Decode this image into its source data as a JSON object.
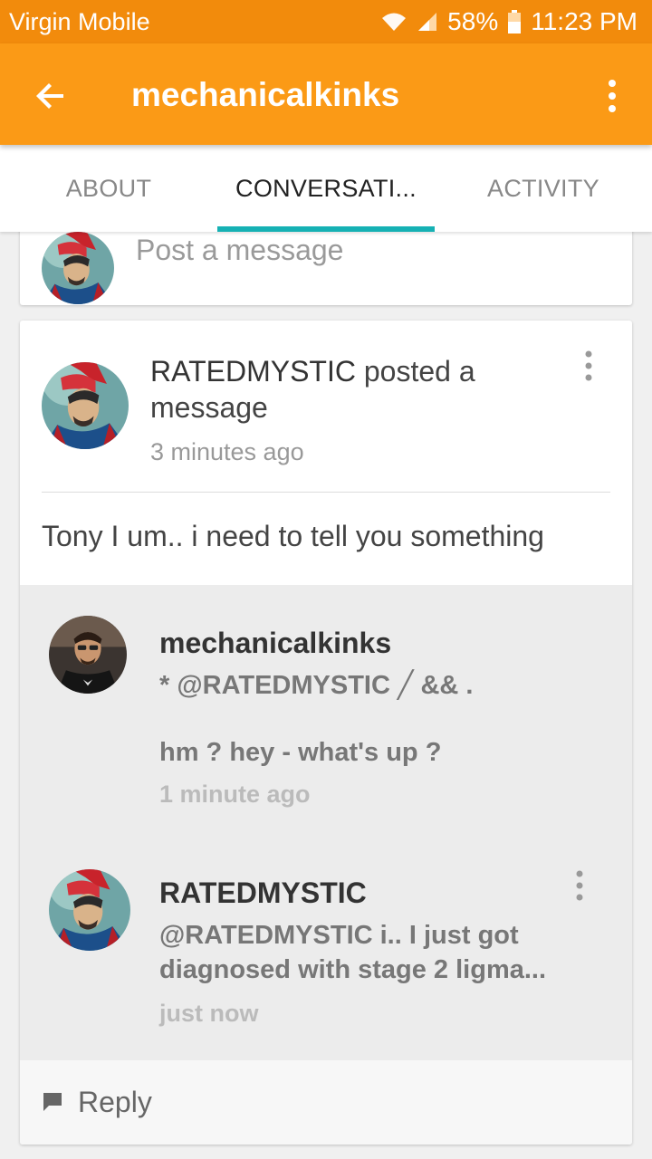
{
  "status_bar": {
    "carrier": "Virgin Mobile",
    "battery": "58%",
    "time": "11:23 PM"
  },
  "app_bar": {
    "title": "mechanicalkinks",
    "back_icon": "arrow-back-icon",
    "menu_icon": "more-vert-icon"
  },
  "tabs": [
    {
      "label": "ABOUT",
      "active": false
    },
    {
      "label": "CONVERSATI...",
      "active": true
    },
    {
      "label": "ACTIVITY",
      "active": false
    }
  ],
  "post_box": {
    "placeholder": "Post a message"
  },
  "post": {
    "author": "RATEDMYSTIC",
    "action": " posted a message",
    "time": "3 minutes ago",
    "body": "Tony I um.. i need to tell you something"
  },
  "comments": [
    {
      "author": "mechanicalkinks",
      "lines": [
        "* @RATEDMYSTIC ╱ && .",
        "hm ? hey - what's up ?"
      ],
      "time": "1 minute ago"
    },
    {
      "author": "RATEDMYSTIC",
      "text": "@RATEDMYSTIC i.. I just got diagnosed with stage 2 ligma...",
      "time": "just now"
    }
  ],
  "reply": {
    "label": "Reply",
    "icon": "comment-icon"
  },
  "colors": {
    "status_bar": "#f28b0c",
    "app_bar": "#fb9a16",
    "tab_indicator": "#16b1b4"
  }
}
